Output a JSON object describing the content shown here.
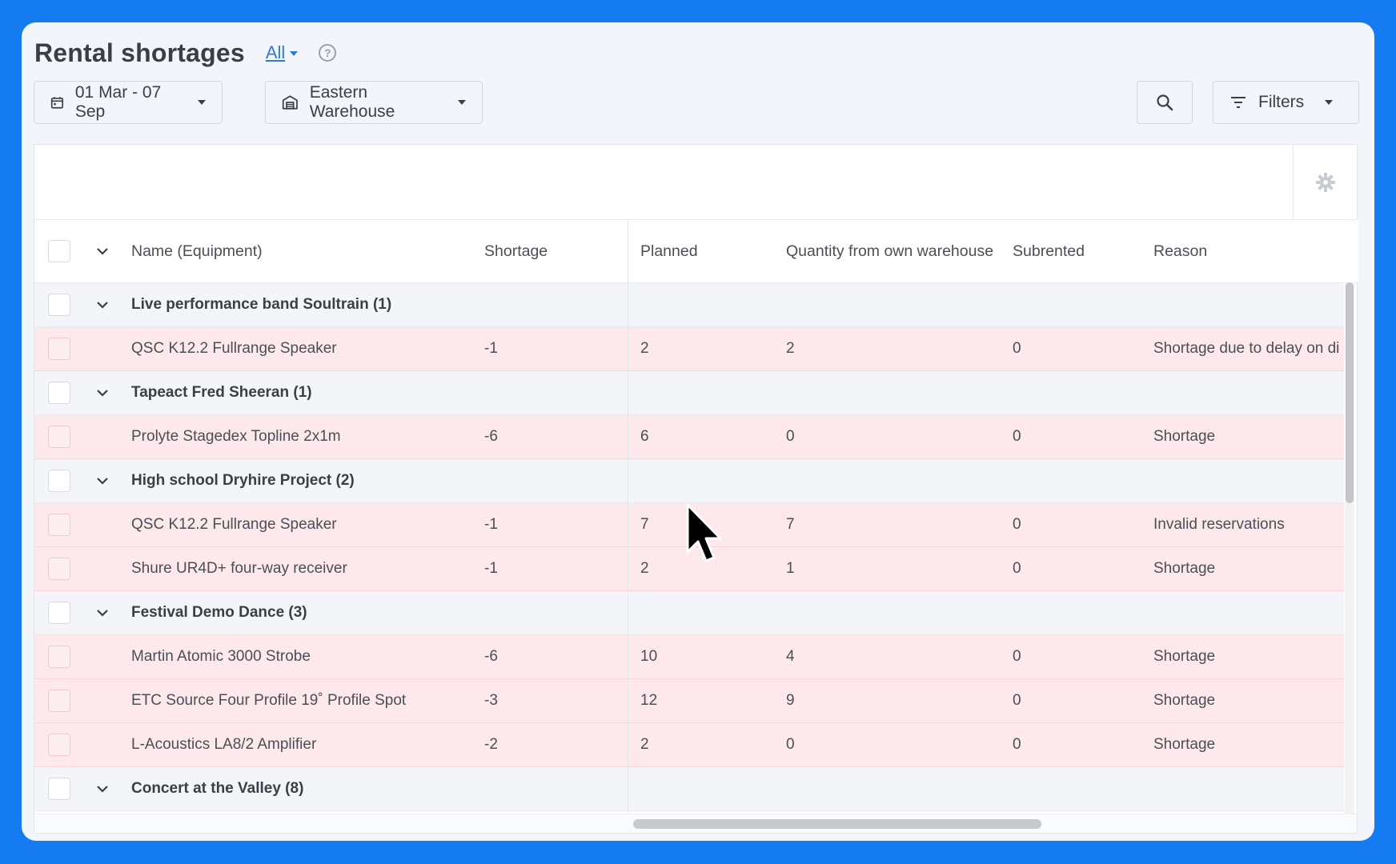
{
  "header": {
    "title": "Rental shortages",
    "scope_label": "All",
    "help_glyph": "?"
  },
  "toolbar": {
    "date_range": "01 Mar - 07 Sep",
    "warehouse": "Eastern Warehouse",
    "filters_label": "Filters"
  },
  "table": {
    "columns": {
      "name": "Name (Equipment)",
      "shortage": "Shortage",
      "planned": "Planned",
      "own_warehouse": "Quantity from own warehouse",
      "subrented": "Subrented",
      "reason": "Reason"
    },
    "groups": [
      {
        "label": "Live performance band Soultrain (1)",
        "items": [
          {
            "name": "QSC K12.2 Fullrange Speaker",
            "shortage": "-1",
            "planned": "2",
            "own": "2",
            "subrented": "0",
            "reason": "Shortage due to delay on di"
          }
        ]
      },
      {
        "label": "Tapeact Fred Sheeran (1)",
        "items": [
          {
            "name": "Prolyte Stagedex Topline 2x1m",
            "shortage": "-6",
            "planned": "6",
            "own": "0",
            "subrented": "0",
            "reason": "Shortage"
          }
        ]
      },
      {
        "label": "High school Dryhire Project (2)",
        "items": [
          {
            "name": "QSC K12.2 Fullrange Speaker",
            "shortage": "-1",
            "planned": "7",
            "own": "7",
            "subrented": "0",
            "reason": "Invalid reservations"
          },
          {
            "name": "Shure UR4D+ four-way receiver",
            "shortage": "-1",
            "planned": "2",
            "own": "1",
            "subrented": "0",
            "reason": "Shortage"
          }
        ]
      },
      {
        "label": "Festival Demo Dance (3)",
        "items": [
          {
            "name": "Martin Atomic 3000 Strobe",
            "shortage": "-6",
            "planned": "10",
            "own": "4",
            "subrented": "0",
            "reason": "Shortage"
          },
          {
            "name": "ETC Source Four Profile 19˚ Profile Spot",
            "shortage": "-3",
            "planned": "12",
            "own": "9",
            "subrented": "0",
            "reason": "Shortage"
          },
          {
            "name": "L-Acoustics LA8/2 Amplifier",
            "shortage": "-2",
            "planned": "2",
            "own": "0",
            "subrented": "0",
            "reason": "Shortage"
          }
        ]
      },
      {
        "label": "Concert at the Valley (8)",
        "items": []
      }
    ]
  },
  "colors": {
    "background": "#147cf0",
    "link": "#2f7ad9",
    "shortage_row": "#fde9ec",
    "group_row": "#f3f5f8"
  }
}
